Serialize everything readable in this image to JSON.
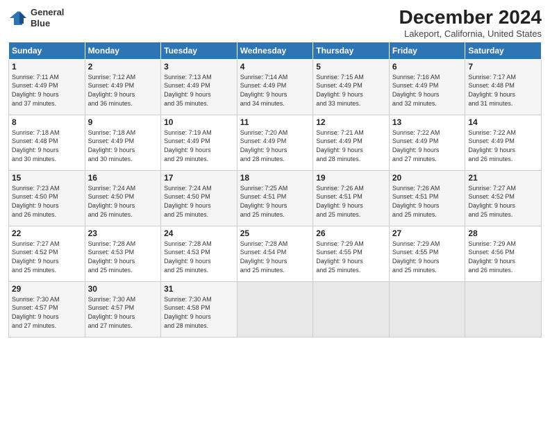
{
  "header": {
    "logo_line1": "General",
    "logo_line2": "Blue",
    "month_title": "December 2024",
    "location": "Lakeport, California, United States"
  },
  "weekdays": [
    "Sunday",
    "Monday",
    "Tuesday",
    "Wednesday",
    "Thursday",
    "Friday",
    "Saturday"
  ],
  "weeks": [
    [
      {
        "day": "1",
        "info": "Sunrise: 7:11 AM\nSunset: 4:49 PM\nDaylight: 9 hours\nand 37 minutes."
      },
      {
        "day": "2",
        "info": "Sunrise: 7:12 AM\nSunset: 4:49 PM\nDaylight: 9 hours\nand 36 minutes."
      },
      {
        "day": "3",
        "info": "Sunrise: 7:13 AM\nSunset: 4:49 PM\nDaylight: 9 hours\nand 35 minutes."
      },
      {
        "day": "4",
        "info": "Sunrise: 7:14 AM\nSunset: 4:49 PM\nDaylight: 9 hours\nand 34 minutes."
      },
      {
        "day": "5",
        "info": "Sunrise: 7:15 AM\nSunset: 4:49 PM\nDaylight: 9 hours\nand 33 minutes."
      },
      {
        "day": "6",
        "info": "Sunrise: 7:16 AM\nSunset: 4:49 PM\nDaylight: 9 hours\nand 32 minutes."
      },
      {
        "day": "7",
        "info": "Sunrise: 7:17 AM\nSunset: 4:48 PM\nDaylight: 9 hours\nand 31 minutes."
      }
    ],
    [
      {
        "day": "8",
        "info": "Sunrise: 7:18 AM\nSunset: 4:48 PM\nDaylight: 9 hours\nand 30 minutes."
      },
      {
        "day": "9",
        "info": "Sunrise: 7:18 AM\nSunset: 4:49 PM\nDaylight: 9 hours\nand 30 minutes."
      },
      {
        "day": "10",
        "info": "Sunrise: 7:19 AM\nSunset: 4:49 PM\nDaylight: 9 hours\nand 29 minutes."
      },
      {
        "day": "11",
        "info": "Sunrise: 7:20 AM\nSunset: 4:49 PM\nDaylight: 9 hours\nand 28 minutes."
      },
      {
        "day": "12",
        "info": "Sunrise: 7:21 AM\nSunset: 4:49 PM\nDaylight: 9 hours\nand 28 minutes."
      },
      {
        "day": "13",
        "info": "Sunrise: 7:22 AM\nSunset: 4:49 PM\nDaylight: 9 hours\nand 27 minutes."
      },
      {
        "day": "14",
        "info": "Sunrise: 7:22 AM\nSunset: 4:49 PM\nDaylight: 9 hours\nand 26 minutes."
      }
    ],
    [
      {
        "day": "15",
        "info": "Sunrise: 7:23 AM\nSunset: 4:50 PM\nDaylight: 9 hours\nand 26 minutes."
      },
      {
        "day": "16",
        "info": "Sunrise: 7:24 AM\nSunset: 4:50 PM\nDaylight: 9 hours\nand 26 minutes."
      },
      {
        "day": "17",
        "info": "Sunrise: 7:24 AM\nSunset: 4:50 PM\nDaylight: 9 hours\nand 25 minutes."
      },
      {
        "day": "18",
        "info": "Sunrise: 7:25 AM\nSunset: 4:51 PM\nDaylight: 9 hours\nand 25 minutes."
      },
      {
        "day": "19",
        "info": "Sunrise: 7:26 AM\nSunset: 4:51 PM\nDaylight: 9 hours\nand 25 minutes."
      },
      {
        "day": "20",
        "info": "Sunrise: 7:26 AM\nSunset: 4:51 PM\nDaylight: 9 hours\nand 25 minutes."
      },
      {
        "day": "21",
        "info": "Sunrise: 7:27 AM\nSunset: 4:52 PM\nDaylight: 9 hours\nand 25 minutes."
      }
    ],
    [
      {
        "day": "22",
        "info": "Sunrise: 7:27 AM\nSunset: 4:52 PM\nDaylight: 9 hours\nand 25 minutes."
      },
      {
        "day": "23",
        "info": "Sunrise: 7:28 AM\nSunset: 4:53 PM\nDaylight: 9 hours\nand 25 minutes."
      },
      {
        "day": "24",
        "info": "Sunrise: 7:28 AM\nSunset: 4:53 PM\nDaylight: 9 hours\nand 25 minutes."
      },
      {
        "day": "25",
        "info": "Sunrise: 7:28 AM\nSunset: 4:54 PM\nDaylight: 9 hours\nand 25 minutes."
      },
      {
        "day": "26",
        "info": "Sunrise: 7:29 AM\nSunset: 4:55 PM\nDaylight: 9 hours\nand 25 minutes."
      },
      {
        "day": "27",
        "info": "Sunrise: 7:29 AM\nSunset: 4:55 PM\nDaylight: 9 hours\nand 25 minutes."
      },
      {
        "day": "28",
        "info": "Sunrise: 7:29 AM\nSunset: 4:56 PM\nDaylight: 9 hours\nand 26 minutes."
      }
    ],
    [
      {
        "day": "29",
        "info": "Sunrise: 7:30 AM\nSunset: 4:57 PM\nDaylight: 9 hours\nand 27 minutes."
      },
      {
        "day": "30",
        "info": "Sunrise: 7:30 AM\nSunset: 4:57 PM\nDaylight: 9 hours\nand 27 minutes."
      },
      {
        "day": "31",
        "info": "Sunrise: 7:30 AM\nSunset: 4:58 PM\nDaylight: 9 hours\nand 28 minutes."
      },
      {
        "day": "",
        "info": ""
      },
      {
        "day": "",
        "info": ""
      },
      {
        "day": "",
        "info": ""
      },
      {
        "day": "",
        "info": ""
      }
    ]
  ]
}
